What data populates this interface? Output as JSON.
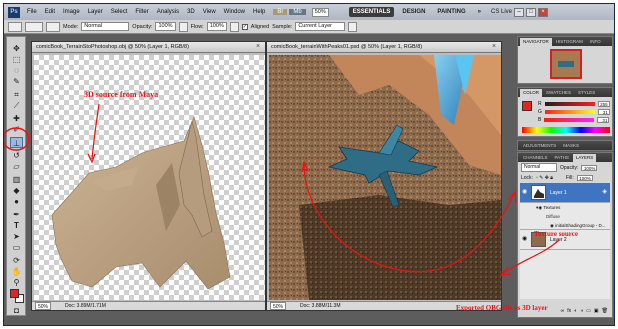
{
  "app": {
    "logo": "Ps"
  },
  "menu": [
    "File",
    "Edit",
    "Image",
    "Layer",
    "Select",
    "Filter",
    "Analysis",
    "3D",
    "View",
    "Window",
    "Help"
  ],
  "zoom_level": "50%",
  "workspaces": {
    "essentials": "ESSENTIALS",
    "design": "DESIGN",
    "painting": "PAINTING",
    "more": "»"
  },
  "cs_live": "CS Live",
  "options": {
    "mode_label": "Mode:",
    "mode_value": "Normal",
    "opacity_label": "Opacity:",
    "opacity_value": "100%",
    "flow_label": "Flow:",
    "flow_value": "100%",
    "aligned_label": "Aligned",
    "sample_label": "Sample:",
    "sample_value": "Current Layer"
  },
  "documents": {
    "left": {
      "title": "comicBook_TerrainStoPhotoshop.obj @ 50% (Layer 1, RGB/8)",
      "zoom": "50%",
      "doc_info": "Doc: 3.89M/1.71M"
    },
    "right": {
      "title": "comicBook_terrainWithPeaks01.psd @ 50% (Layer 1, RGB/8)",
      "zoom": "50%",
      "doc_info": "Doc: 3.88M/11.3M"
    }
  },
  "navigator": {
    "tabs": [
      "NAVIGATOR",
      "HISTOGRAM",
      "INFO"
    ]
  },
  "color_panel": {
    "tabs": [
      "COLOR",
      "SWATCHES",
      "STYLES"
    ],
    "r": {
      "label": "R",
      "value": "255"
    },
    "g": {
      "label": "G",
      "value": "31"
    },
    "b": {
      "label": "B",
      "value": "31"
    },
    "foreground_color": "#e52421"
  },
  "adjustments": {
    "tabs": [
      "ADJUSTMENTS",
      "MASKS"
    ]
  },
  "layers_panel": {
    "tabs": [
      "CHANNELS",
      "PATHS",
      "LAYERS"
    ],
    "blend_mode": "Normal",
    "opacity_label": "Opacity:",
    "opacity_value": "100%",
    "lock_label": "Lock:",
    "fill_label": "Fill:",
    "fill_value": "100%",
    "layers": [
      {
        "name": "Layer 1",
        "selected": true
      },
      {
        "name": "Layer 2",
        "selected": false
      }
    ],
    "sub_items": [
      "Textures",
      "Diffuse",
      "initialShadingGroup - D..."
    ]
  },
  "annotations": {
    "maya": "3D source from Maya",
    "texture": "Texture source",
    "exported": "Exported OBG file as 3D layer",
    "color": "#e11111"
  }
}
